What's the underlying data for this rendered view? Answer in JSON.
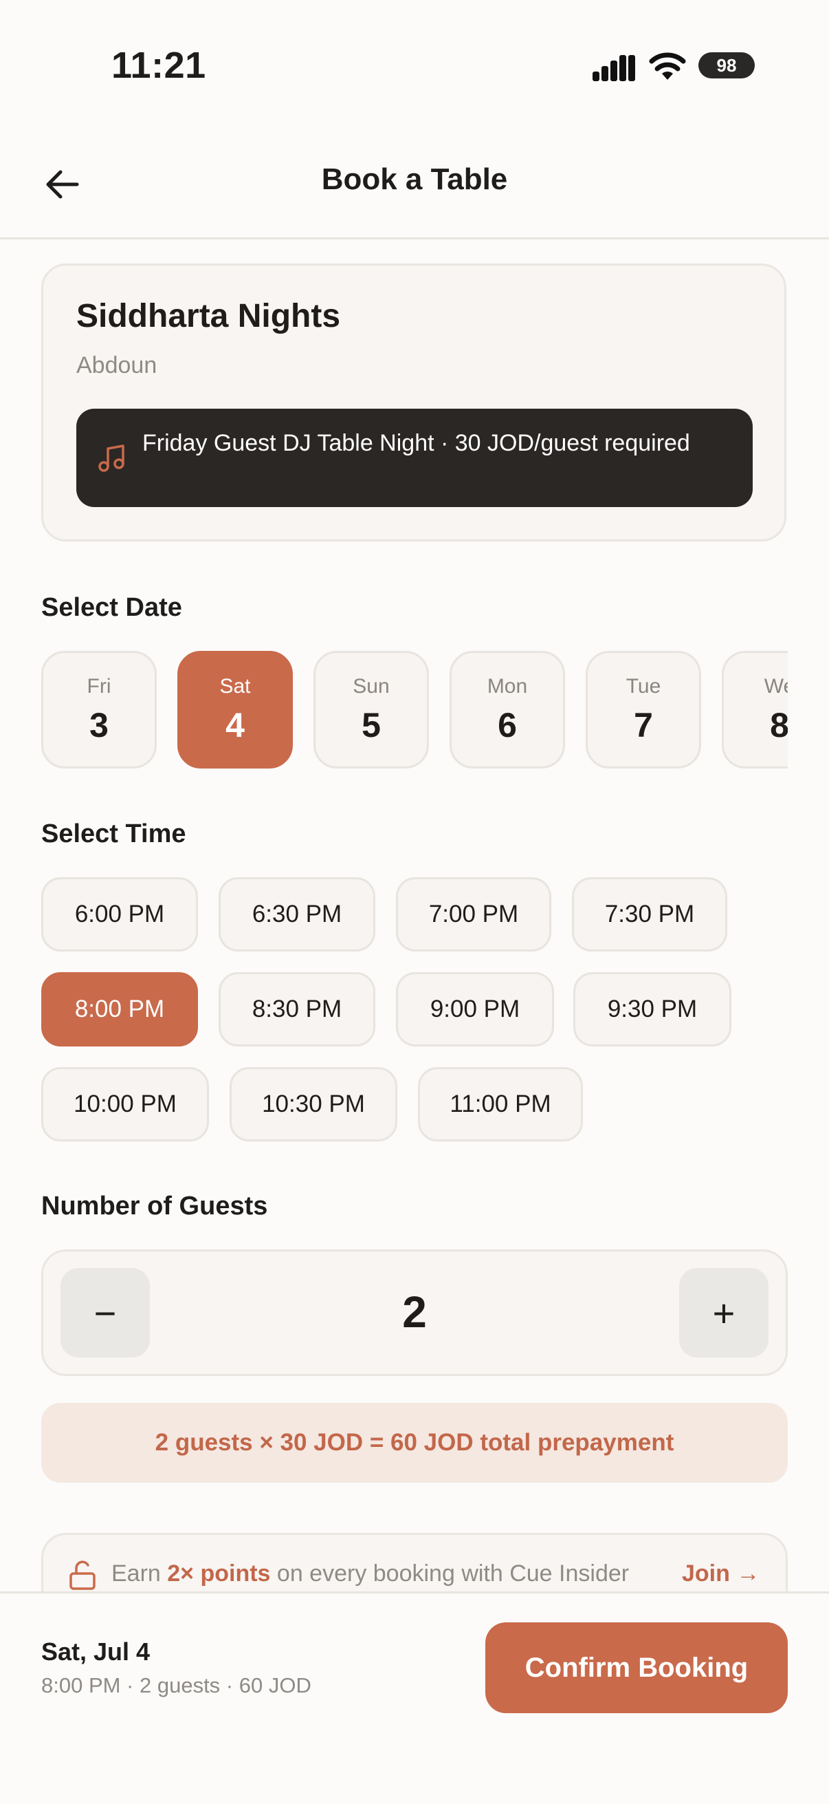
{
  "status_bar": {
    "time": "11:21",
    "battery": "98"
  },
  "header": {
    "title": "Book a Table",
    "back_icon": "arrow-left-icon"
  },
  "venue": {
    "name": "Siddharta Nights",
    "area": "Abdoun",
    "banner_icon": "music-note-icon",
    "banner_text": "Friday Guest DJ Table Night · 30 JOD/guest required"
  },
  "date_section": {
    "label": "Select Date",
    "dates": [
      {
        "dow": "Fri",
        "num": "3"
      },
      {
        "dow": "Sat",
        "num": "4",
        "selected": true
      },
      {
        "dow": "Sun",
        "num": "5"
      },
      {
        "dow": "Mon",
        "num": "6"
      },
      {
        "dow": "Tue",
        "num": "7"
      },
      {
        "dow": "We",
        "num": "8"
      }
    ]
  },
  "time_section": {
    "label": "Select Time",
    "times": [
      "6:00 PM",
      "6:30 PM",
      "7:00 PM",
      "7:30 PM",
      "8:00 PM",
      "8:30 PM",
      "9:00 PM",
      "9:30 PM",
      "10:00 PM",
      "10:30 PM",
      "11:00 PM"
    ],
    "selected": "8:00 PM"
  },
  "guests": {
    "label": "Number of Guests",
    "minus": "−",
    "plus": "+",
    "count": "2",
    "prepay_text": "2 guests × 30 JOD = 60 JOD total prepayment"
  },
  "insider": {
    "icon": "lock-open-icon",
    "text_prefix": "Earn ",
    "text_bold": "2× points",
    "text_suffix": " on every booking with Cue Insider",
    "join": "Join →"
  },
  "summary": {
    "date": "Sat, Jul 4",
    "detail": "8:00 PM · 2 guests · 60 JOD",
    "confirm": "Confirm Booking"
  },
  "colors": {
    "accent": "#C96A4B",
    "banner_bg": "#2B2725",
    "prepay_bg": "#F5E8E1"
  }
}
